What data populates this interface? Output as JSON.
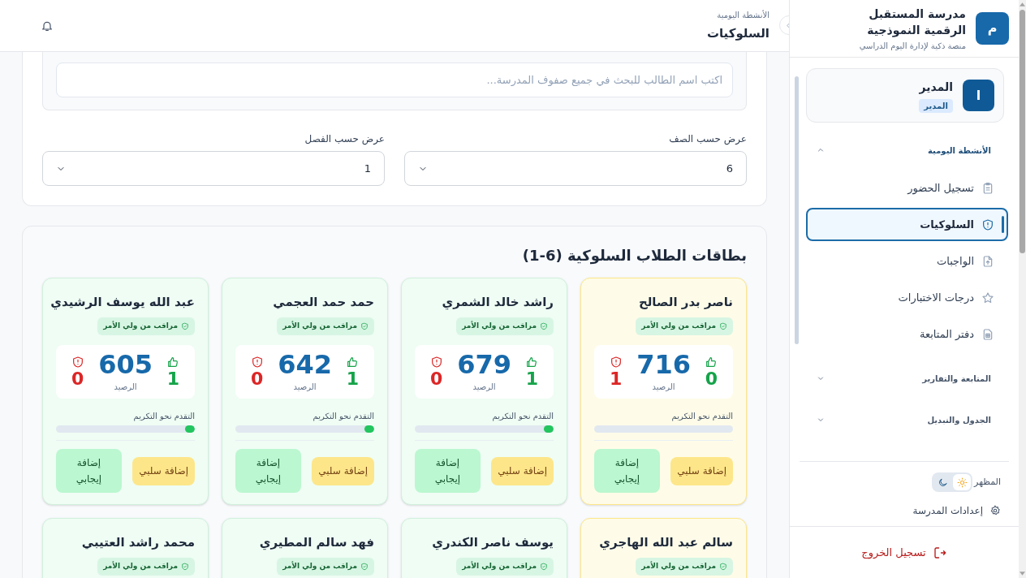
{
  "header": {
    "breadcrumb": "الأنشطة اليومية",
    "title": "السلوكيات"
  },
  "sidebar": {
    "logo_letter": "م",
    "school_name": [
      "مدرسة المستقبل",
      "الرقمية النموذجية"
    ],
    "tagline": "منصة ذكية لإدارة اليوم الدراسي",
    "user": {
      "avatar_letter": "ا",
      "name": "المدير",
      "role": "المدير"
    },
    "nav": [
      {
        "label": "الأنشطة اليومية",
        "expanded": true,
        "children": [
          {
            "label": "تسجيل الحضور",
            "selected": false
          },
          {
            "label": "السلوكيات",
            "selected": true
          },
          {
            "label": "الواجبات",
            "selected": false
          },
          {
            "label": "درجات الاختبارات",
            "selected": false
          },
          {
            "label": "دفتر المتابعة",
            "selected": false
          }
        ]
      },
      {
        "label": "المتابعة والتقارير",
        "expanded": false
      },
      {
        "label": "الجدول والتبديل",
        "expanded": false
      }
    ],
    "theme": {
      "label": "المظهر",
      "dark_mode": false
    },
    "settings": "إعدادات المدرسة",
    "logout": "تسجيل الخروج"
  },
  "search": {
    "placeholder": "اكتب اسم الطالب للبحث في جميع صفوف المدرسة..."
  },
  "filters": [
    {
      "label": "عرض حسب الصف",
      "value": "6"
    },
    {
      "label": "عرض حسب الفصل",
      "value": "1"
    }
  ],
  "cards_title": "بطاقات الطلاب السلوكية (6-1)",
  "students": [
    {
      "name": "ناصر بدر الصالح",
      "highlighted": true,
      "badge": "مراقب من ولي الأمر",
      "positive": "0",
      "balance": "716",
      "negative": "1",
      "balance_label": "الرصيد",
      "progress_label": "التقدم نحو التكريم",
      "level": 0,
      "buttons": [
        "إضافة سلبي",
        "إضافة إيجابي"
      ]
    },
    {
      "name": "راشد خالد الشمري",
      "highlighted": false,
      "badge": "مراقب من ولي الأمر",
      "positive": "1",
      "balance": "679",
      "negative": "0",
      "balance_label": "الرصيد",
      "progress_label": "التقدم نحو التكريم",
      "level": 0.07,
      "buttons": [
        "إضافة سلبي",
        "إضافة إيجابي"
      ]
    },
    {
      "name": "حمد حمد العجمي",
      "highlighted": false,
      "badge": "مراقب من ولي الأمر",
      "positive": "1",
      "balance": "642",
      "negative": "0",
      "balance_label": "الرصيد",
      "progress_label": "التقدم نحو التكريم",
      "level": 0.07,
      "buttons": [
        "إضافة سلبي",
        "إضافة إيجابي"
      ]
    },
    {
      "name": "عبد الله يوسف الرشيدي",
      "highlighted": false,
      "badge": "مراقب من ولي الأمر",
      "positive": "1",
      "balance": "605",
      "negative": "0",
      "balance_label": "الرصيد",
      "progress_label": "التقدم نحو التكريم",
      "level": 0.07,
      "buttons": [
        "إضافة سلبي",
        "إضافة إيجابي"
      ]
    },
    {
      "name": "سالم عبد الله الهاجري",
      "highlighted": true,
      "badge": "مراقب من ولي الأمر"
    },
    {
      "name": "يوسف ناصر الكندري",
      "highlighted": false,
      "badge": "مراقب من ولي الأمر"
    },
    {
      "name": "فهد سالم المطيري",
      "highlighted": false,
      "badge": "مراقب من ولي الأمر"
    },
    {
      "name": "محمد راشد العتيبي",
      "highlighted": false,
      "badge": "مراقب من ولي الأمر"
    }
  ]
}
